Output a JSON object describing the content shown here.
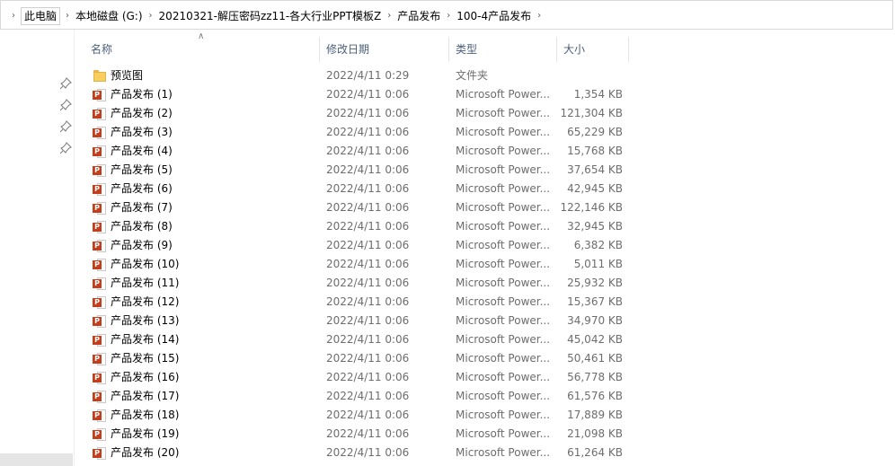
{
  "breadcrumb": {
    "items": [
      "此电脑",
      "本地磁盘 (G:)",
      "20210321-解压密码zz11-各大行业PPT模板Z",
      "产品发布",
      "100-4产品发布"
    ]
  },
  "columns": {
    "name": "名称",
    "date": "修改日期",
    "type": "类型",
    "size": "大小"
  },
  "icons": {
    "chevron": "chevron-right-icon",
    "pin": "pin-icon",
    "folder": "folder-icon",
    "ppt": "powerpoint-file-icon",
    "sort": "sort-up-icon"
  },
  "files": [
    {
      "name": "预览图",
      "date": "2022/4/11 0:29",
      "type": "文件夹",
      "size": "",
      "kind": "folder"
    },
    {
      "name": "产品发布 (1)",
      "date": "2022/4/11 0:06",
      "type": "Microsoft Power...",
      "size": "1,354 KB",
      "kind": "ppt"
    },
    {
      "name": "产品发布 (2)",
      "date": "2022/4/11 0:06",
      "type": "Microsoft Power...",
      "size": "121,304 KB",
      "kind": "ppt"
    },
    {
      "name": "产品发布 (3)",
      "date": "2022/4/11 0:06",
      "type": "Microsoft Power...",
      "size": "65,229 KB",
      "kind": "ppt"
    },
    {
      "name": "产品发布 (4)",
      "date": "2022/4/11 0:06",
      "type": "Microsoft Power...",
      "size": "15,768 KB",
      "kind": "ppt"
    },
    {
      "name": "产品发布 (5)",
      "date": "2022/4/11 0:06",
      "type": "Microsoft Power...",
      "size": "37,654 KB",
      "kind": "ppt"
    },
    {
      "name": "产品发布 (6)",
      "date": "2022/4/11 0:06",
      "type": "Microsoft Power...",
      "size": "42,945 KB",
      "kind": "ppt"
    },
    {
      "name": "产品发布 (7)",
      "date": "2022/4/11 0:06",
      "type": "Microsoft Power...",
      "size": "122,146 KB",
      "kind": "ppt"
    },
    {
      "name": "产品发布 (8)",
      "date": "2022/4/11 0:06",
      "type": "Microsoft Power...",
      "size": "32,945 KB",
      "kind": "ppt"
    },
    {
      "name": "产品发布 (9)",
      "date": "2022/4/11 0:06",
      "type": "Microsoft Power...",
      "size": "6,382 KB",
      "kind": "ppt"
    },
    {
      "name": "产品发布 (10)",
      "date": "2022/4/11 0:06",
      "type": "Microsoft Power...",
      "size": "5,011 KB",
      "kind": "ppt"
    },
    {
      "name": "产品发布 (11)",
      "date": "2022/4/11 0:06",
      "type": "Microsoft Power...",
      "size": "25,932 KB",
      "kind": "ppt"
    },
    {
      "name": "产品发布 (12)",
      "date": "2022/4/11 0:06",
      "type": "Microsoft Power...",
      "size": "15,367 KB",
      "kind": "ppt"
    },
    {
      "name": "产品发布 (13)",
      "date": "2022/4/11 0:06",
      "type": "Microsoft Power...",
      "size": "34,970 KB",
      "kind": "ppt"
    },
    {
      "name": "产品发布 (14)",
      "date": "2022/4/11 0:06",
      "type": "Microsoft Power...",
      "size": "45,042 KB",
      "kind": "ppt"
    },
    {
      "name": "产品发布 (15)",
      "date": "2022/4/11 0:06",
      "type": "Microsoft Power...",
      "size": "50,461 KB",
      "kind": "ppt"
    },
    {
      "name": "产品发布 (16)",
      "date": "2022/4/11 0:06",
      "type": "Microsoft Power...",
      "size": "56,778 KB",
      "kind": "ppt"
    },
    {
      "name": "产品发布 (17)",
      "date": "2022/4/11 0:06",
      "type": "Microsoft Power...",
      "size": "61,576 KB",
      "kind": "ppt"
    },
    {
      "name": "产品发布 (18)",
      "date": "2022/4/11 0:06",
      "type": "Microsoft Power...",
      "size": "17,889 KB",
      "kind": "ppt"
    },
    {
      "name": "产品发布 (19)",
      "date": "2022/4/11 0:06",
      "type": "Microsoft Power...",
      "size": "21,098 KB",
      "kind": "ppt"
    },
    {
      "name": "产品发布 (20)",
      "date": "2022/4/11 0:06",
      "type": "Microsoft Power...",
      "size": "61,264 KB",
      "kind": "ppt"
    }
  ]
}
